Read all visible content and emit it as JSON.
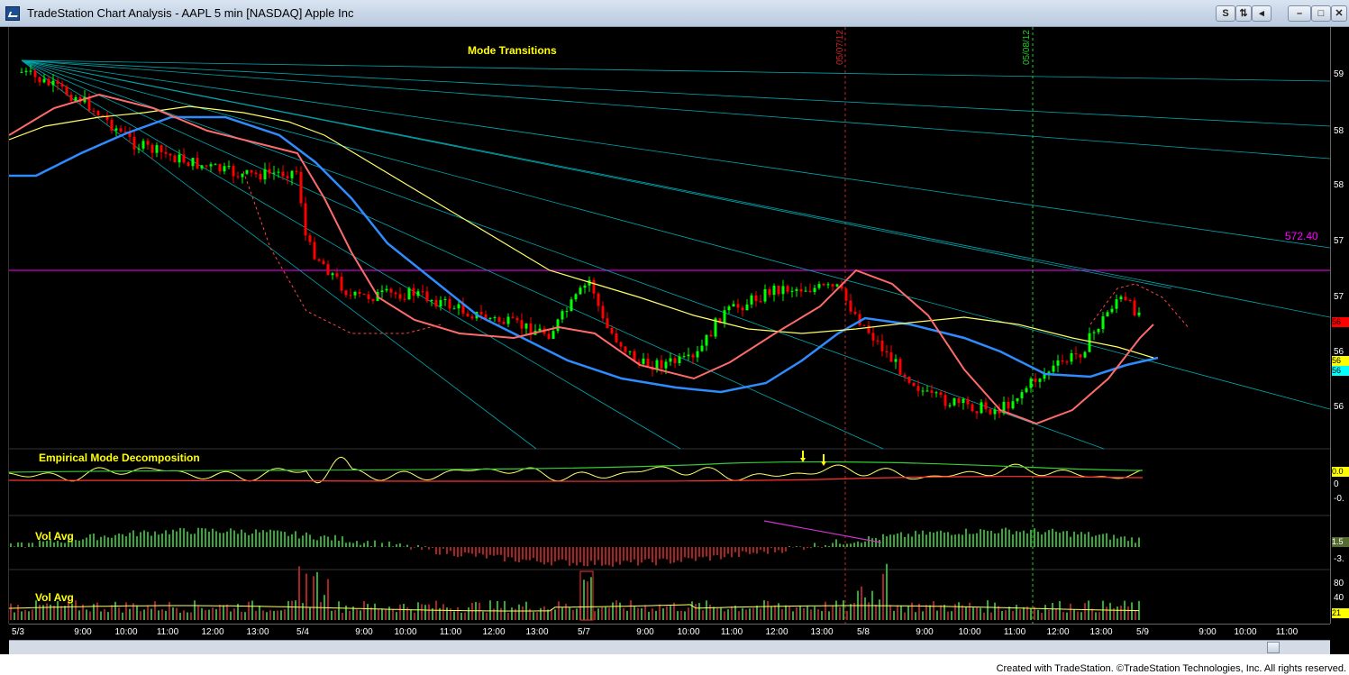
{
  "window": {
    "title": "TradeStation Chart Analysis - AAPL 5 min [NASDAQ] Apple Inc",
    "buttons": [
      "S",
      "⇅",
      "◂",
      "–",
      "□",
      "✕"
    ]
  },
  "colors": {
    "price_up": "#00ff00",
    "price_down": "#ff0000",
    "fan_lines": "#00a8b0",
    "moving_avg_blue": "#2f8cff",
    "moving_avg_pink": "#ff6b6b",
    "moving_avg_yellow": "#ffff66",
    "horizontal_line": "#cc00cc",
    "emd_line": "#ffff66"
  },
  "panels": {
    "price": {
      "title": "Mode Transitions"
    },
    "emd": {
      "title": "Empirical Mode Decomposition"
    },
    "vol1": {
      "title": "Vol Avg"
    },
    "vol2": {
      "title": "Vol Avg"
    }
  },
  "horizontal_line": {
    "label": "572.40",
    "value": 572.4
  },
  "date_markers": [
    {
      "label": "05/07/12",
      "color": "#cc2222"
    },
    {
      "label": "05/08/12",
      "color": "#22cc22"
    }
  ],
  "right_axis": {
    "price_labels": [
      "59",
      "58",
      "58",
      "57",
      "57",
      "56",
      "56"
    ],
    "badges": [
      {
        "label": "56",
        "bg": "#ff0000"
      },
      {
        "label": "56",
        "bg": "#ffff00"
      },
      {
        "label": "56",
        "bg": "#00ffff"
      }
    ],
    "emd_labels": [
      "0.0",
      "0",
      "-0."
    ],
    "emd_badge": {
      "label": "0.0",
      "bg": "#ffff00"
    },
    "vol1_labels": [
      "1.5",
      "-3."
    ],
    "vol2_labels": [
      "80",
      "40",
      "21"
    ]
  },
  "time_axis": [
    "5/3",
    "9:00",
    "10:00",
    "11:00",
    "12:00",
    "13:00",
    "5/4",
    "9:00",
    "10:00",
    "11:00",
    "12:00",
    "13:00",
    "5/7",
    "9:00",
    "10:00",
    "11:00",
    "12:00",
    "13:00",
    "5/8",
    "9:00",
    "10:00",
    "11:00",
    "12:00",
    "13:00",
    "5/9",
    "9:00",
    "10:00",
    "11:00"
  ],
  "footer": {
    "text": "Created with TradeStation. ©TradeStation Technologies, Inc. All rights reserved."
  }
}
